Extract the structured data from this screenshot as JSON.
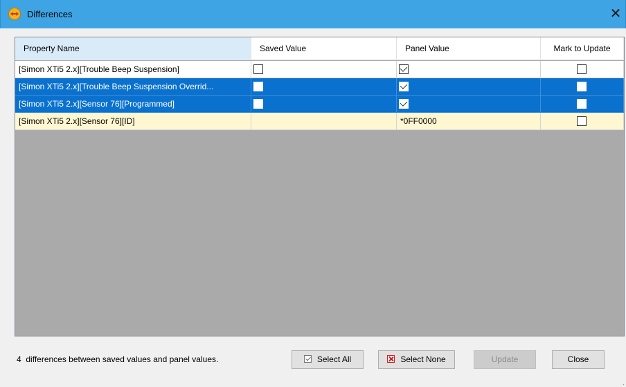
{
  "window": {
    "title": "Differences",
    "close_glyph": "✕"
  },
  "grid": {
    "columns": [
      "Property Name",
      "Saved Value",
      "Panel Value",
      "Mark to Update"
    ],
    "rows": [
      {
        "property": "[Simon XTi5 2.x][Trouble Beep Suspension]",
        "saved": {
          "type": "checkbox",
          "checked": false
        },
        "panel": {
          "type": "checkbox",
          "checked": true
        },
        "mark": false,
        "state": "normal"
      },
      {
        "property": "[Simon XTi5 2.x][Trouble Beep Suspension Overrid...",
        "saved": {
          "type": "checkbox",
          "checked": false
        },
        "panel": {
          "type": "checkbox",
          "checked": true
        },
        "mark": false,
        "state": "selected"
      },
      {
        "property": "[Simon XTi5 2.x][Sensor 76][Programmed]",
        "saved": {
          "type": "checkbox",
          "checked": false
        },
        "panel": {
          "type": "checkbox",
          "checked": true
        },
        "mark": false,
        "state": "selected"
      },
      {
        "property": "[Simon XTi5 2.x][Sensor 76][ID]",
        "saved": {
          "type": "text",
          "value": ""
        },
        "panel": {
          "type": "text",
          "value": "*0FF0000"
        },
        "mark": false,
        "state": "changed"
      }
    ]
  },
  "footer": {
    "status_count": "4",
    "status_text": "differences between saved values and panel values.",
    "select_all_label": "Select All",
    "select_none_label": "Select None",
    "update_label": "Update",
    "close_label": "Close"
  },
  "colors": {
    "titlebar": "#3ea4e4",
    "selected_row": "#0a71ce",
    "changed_row": "#fff7d2",
    "grid_empty": "#aaaaaa"
  },
  "icons": {
    "app": "diamond-arrows-icon",
    "select_all": "checkbox-checked-icon",
    "select_none": "checkbox-x-icon"
  }
}
